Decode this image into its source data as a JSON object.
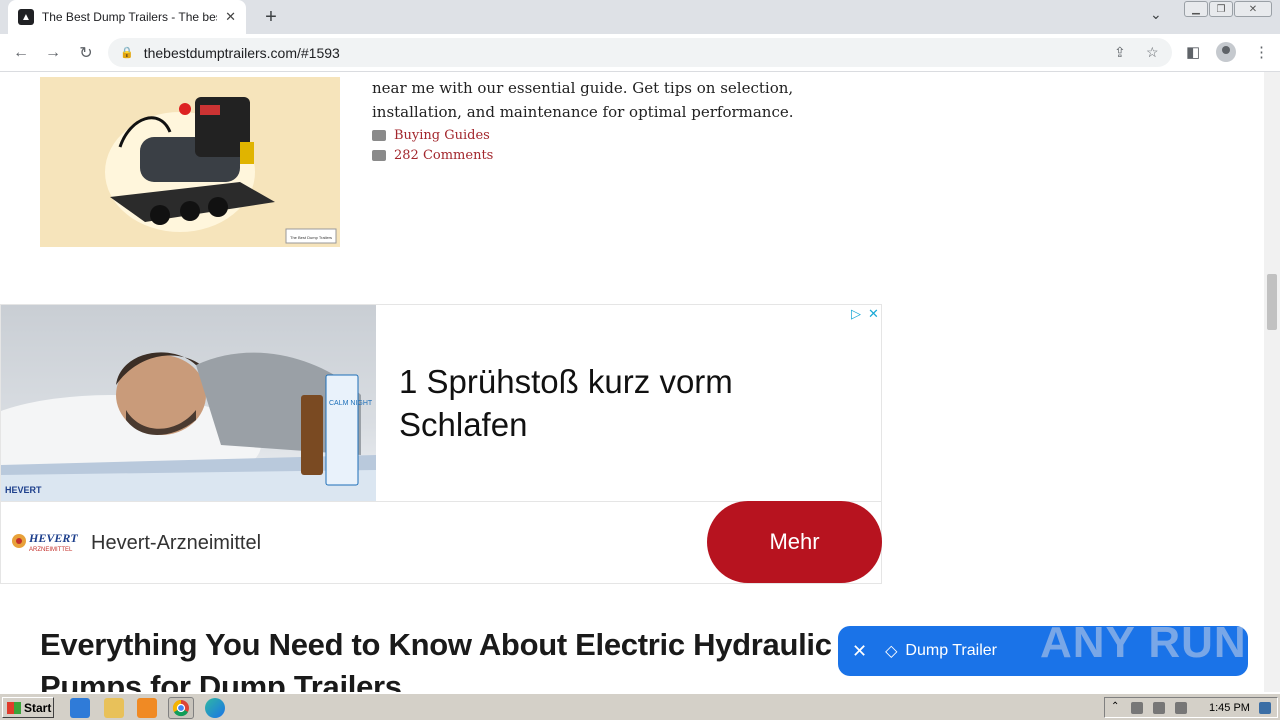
{
  "browser": {
    "tab_title": "The Best Dump Trailers - The best du",
    "tab_close": "✕",
    "new_tab": "+",
    "url": "thebestdumptrailers.com/#1593"
  },
  "post": {
    "excerpt": "near me with our essential guide. Get tips on selection, installation, and maintenance for optimal performance.",
    "category": "Buying Guides",
    "comments": "282 Comments",
    "thumbnail_caption": "The Best Dump Trailers"
  },
  "ad": {
    "headline": "1 Sprühstoß kurz vorm Schlafen",
    "brand": "Hevert-Arzneimittel",
    "cta": "Mehr",
    "logo_text": "HEVERT",
    "logo_subtext": "ARZNEIMITTEL",
    "product_text": "CALM NIGHT"
  },
  "article": {
    "title": "Everything You Need to Know About Electric Hydraulic Pumps for Dump Trailers"
  },
  "tag_bar": {
    "label": "Dump Trailer"
  },
  "watermark": "ANY RUN",
  "taskbar": {
    "start": "Start",
    "clock": "1:45 PM"
  },
  "colors": {
    "link": "#a3272d",
    "cta": "#b7131f",
    "tag_bar": "#1a73e8"
  }
}
